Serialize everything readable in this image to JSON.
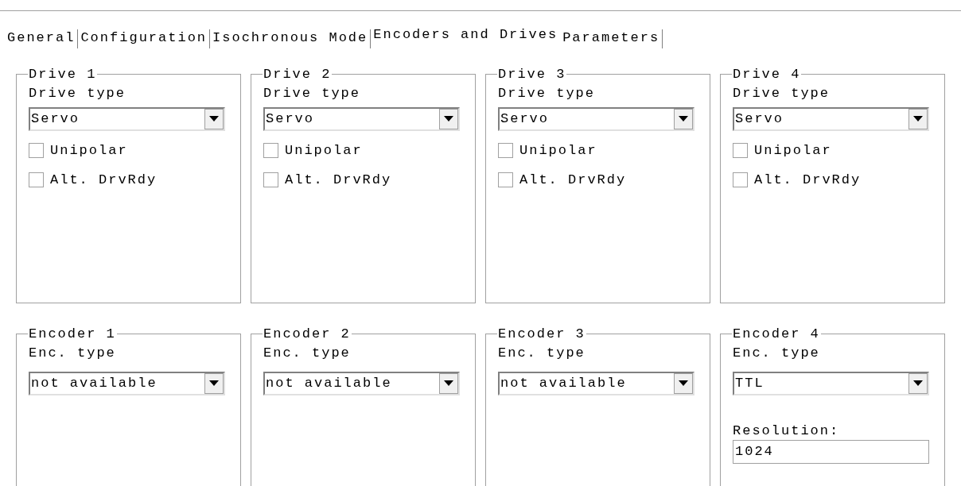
{
  "tabs": [
    {
      "label": "General",
      "selected": false
    },
    {
      "label": "Configuration",
      "selected": false
    },
    {
      "label": "Isochronous Mode",
      "selected": false
    },
    {
      "label": "Encoders and Drives",
      "selected": true
    },
    {
      "label": "Parameters",
      "selected": false
    }
  ],
  "drives": [
    {
      "title": "Drive 1",
      "type_label": "Drive type",
      "type_value": "Servo",
      "options": [
        {
          "label": "Unipolar",
          "checked": false
        },
        {
          "label": "Alt. DrvRdy",
          "checked": false
        }
      ]
    },
    {
      "title": "Drive 2",
      "type_label": "Drive type",
      "type_value": "Servo",
      "options": [
        {
          "label": "Unipolar",
          "checked": false
        },
        {
          "label": "Alt. DrvRdy",
          "checked": false
        }
      ]
    },
    {
      "title": "Drive 3",
      "type_label": "Drive type",
      "type_value": "Servo",
      "options": [
        {
          "label": "Unipolar",
          "checked": false
        },
        {
          "label": "Alt. DrvRdy",
          "checked": false
        }
      ]
    },
    {
      "title": "Drive 4",
      "type_label": "Drive type",
      "type_value": "Servo",
      "options": [
        {
          "label": "Unipolar",
          "checked": false
        },
        {
          "label": "Alt. DrvRdy",
          "checked": false
        }
      ]
    }
  ],
  "encoders": [
    {
      "title": "Encoder 1",
      "type_label": "Enc. type",
      "type_value": "not available"
    },
    {
      "title": "Encoder 2",
      "type_label": "Enc. type",
      "type_value": "not available"
    },
    {
      "title": "Encoder 3",
      "type_label": "Enc. type",
      "type_value": "not available"
    },
    {
      "title": "Encoder 4",
      "type_label": "Enc. type",
      "type_value": "TTL",
      "resolution": {
        "label": "Resolution:",
        "value": "1024"
      }
    }
  ]
}
